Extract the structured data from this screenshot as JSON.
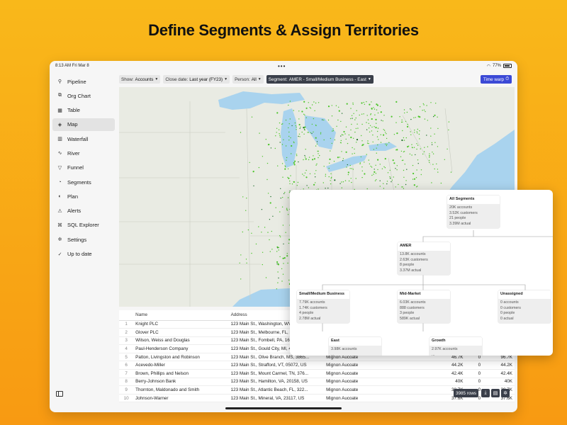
{
  "headline": "Define Segments  & Assign Territories",
  "status": {
    "time": "8:13 AM",
    "date": "Fri Mar 8",
    "dots": "•••",
    "battery": "77%"
  },
  "sidebar": {
    "items": [
      {
        "label": "Pipeline",
        "icon": "pipeline-icon",
        "active": false
      },
      {
        "label": "Org Chart",
        "icon": "org-chart-icon",
        "active": false
      },
      {
        "label": "Table",
        "icon": "table-icon",
        "active": false
      },
      {
        "label": "Map",
        "icon": "map-icon",
        "active": true
      },
      {
        "label": "Waterfall",
        "icon": "waterfall-icon",
        "active": false
      },
      {
        "label": "River",
        "icon": "river-icon",
        "active": false
      },
      {
        "label": "Funnel",
        "icon": "funnel-icon",
        "active": false
      },
      {
        "label": "Segments",
        "icon": "segments-icon",
        "active": false
      },
      {
        "label": "Plan",
        "icon": "plan-icon",
        "active": false
      },
      {
        "label": "Alerts",
        "icon": "alerts-icon",
        "active": false
      },
      {
        "label": "SQL Explorer",
        "icon": "sql-icon",
        "active": false
      },
      {
        "label": "Settings",
        "icon": "gear-icon",
        "active": false
      },
      {
        "label": "Up to date",
        "icon": "check-circle-icon",
        "active": false
      }
    ]
  },
  "toolbar": {
    "show_label": "Show:",
    "show_value": "Accounts",
    "close_label": "Close date:",
    "close_value": "Last year (FY23)",
    "person_label": "Person:",
    "person_value": "All",
    "segment_label": "Segment:",
    "segment_value": "AMER - Small/Medium Business - East",
    "time_warp": "Time warp"
  },
  "table": {
    "headers": [
      "",
      "Name",
      "Address",
      "",
      "",
      "",
      ""
    ],
    "rows": [
      [
        "1",
        "Knight PLC",
        "123 Main St., Washington, WV, 26...",
        "",
        "",
        "",
        ""
      ],
      [
        "2",
        "Glover PLC",
        "123 Main St., Melbourne, FL, 3290...",
        "",
        "",
        "",
        ""
      ],
      [
        "3",
        "Wilson, Weiss and Douglas",
        "123 Main St., Fombell, PA, 16123,...",
        "",
        "",
        "",
        ""
      ],
      [
        "4",
        "Paul-Henderson Company",
        "123 Main St., Gould City, MI, 4983...",
        "",
        "",
        "",
        ""
      ],
      [
        "5",
        "Patton, Livingston and Robinson",
        "123 Main St., Olive Branch, MS, 3865...",
        "Mignon Aucoate",
        "46.7K",
        "0",
        "96.7K"
      ],
      [
        "6",
        "Acevedo-Miller",
        "123 Main St., Strafford, VT, 05072, US",
        "Mignon Aucoate",
        "44.2K",
        "0",
        "44.2K"
      ],
      [
        "7",
        "Brown, Phillips and Nelson",
        "123 Main St., Mount Carmel, TN, 376...",
        "Mignon Aucoate",
        "42.4K",
        "0",
        "42.4K"
      ],
      [
        "8",
        "Berry-Johnson Bank",
        "123 Main St., Hamilton, VA, 20158, US",
        "Mignon Aucoate",
        "40K",
        "0",
        "40K"
      ],
      [
        "9",
        "Thornton, Maldonado and Smith",
        "123 Main St., Atlantic Beach, FL, 322...",
        "Mignon Aucoate",
        "38.7K",
        "0",
        "38.7K"
      ],
      [
        "10",
        "Johnson-Warner",
        "123 Main St., Mineral, VA, 23117, US",
        "Mignon Aucoate",
        "37.6K",
        "0",
        "37.6K"
      ]
    ],
    "rows_badge": "3985 rows"
  },
  "tree": {
    "all": {
      "title": "All Segments",
      "lines": [
        "20K accounts",
        "3.52K customers",
        "21 people",
        "3.39M actual"
      ]
    },
    "amer": {
      "title": "AMER",
      "lines": [
        "13.8K accounts",
        "2.63K customers",
        "8 people",
        "3.37M actual"
      ]
    },
    "smb": {
      "title": "Small/Medium Business",
      "lines": [
        "7.79K accounts",
        "1.74K customers",
        "4 people",
        "2.78M actual"
      ]
    },
    "mid": {
      "title": "Mid-Market",
      "lines": [
        "6.03K accounts",
        "888 customers",
        "3 people",
        "589K actual"
      ]
    },
    "unassigned": {
      "title": "Unassigned",
      "lines": [
        "0 accounts",
        "0 customers",
        "0 people",
        "0 actual"
      ]
    },
    "east": {
      "title": "East",
      "lines": [
        "3.98K accounts",
        "..."
      ]
    },
    "growth": {
      "title": "Growth",
      "lines": [
        "2.97K accounts",
        "..."
      ]
    }
  },
  "colors": {
    "accent": "#3b49d6",
    "dot_green": "#4cc52a",
    "dot_dark": "#1f6f2a",
    "water": "#a9d3ee",
    "land": "#e9ebe3"
  }
}
